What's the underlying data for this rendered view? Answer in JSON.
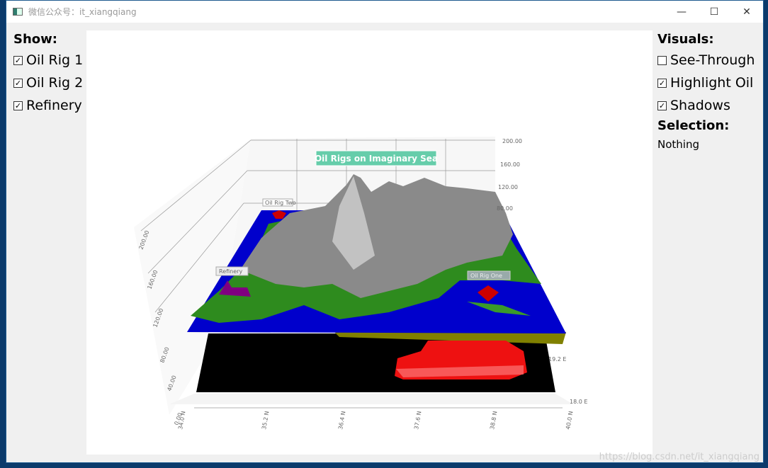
{
  "window": {
    "title": "微信公众号：it_xiangqiang",
    "minimize": "—",
    "maximize": "☐",
    "close": "✕"
  },
  "show": {
    "header": "Show:",
    "items": [
      {
        "label": "Oil Rig 1",
        "checked": true
      },
      {
        "label": "Oil Rig 2",
        "checked": true
      },
      {
        "label": "Refinery",
        "checked": true
      }
    ]
  },
  "visuals": {
    "header": "Visuals:",
    "items": [
      {
        "label": "See-Through",
        "checked": false
      },
      {
        "label": "Highlight Oil",
        "checked": true
      },
      {
        "label": "Shadows",
        "checked": true
      }
    ]
  },
  "selection": {
    "header": "Selection:",
    "value": "Nothing"
  },
  "graph": {
    "title": "Oil Rigs on Imaginary Sea",
    "title_color": "#66cdaa",
    "labels": {
      "rig1": "Oil Rig One",
      "rig2": "Oil Rig Two",
      "refinery": "Refinery"
    },
    "y_ticks_right": [
      "200.00",
      "160.00",
      "120.00",
      "80.00"
    ],
    "y_ticks_left": [
      "200.00",
      "160.00",
      "120.00",
      "80.00",
      "40.00",
      "0.00"
    ],
    "x_ticks": [
      "34.0 N",
      "35.2 N",
      "36.4 N",
      "37.6 N",
      "38.8 N",
      "40.0 N"
    ],
    "z_ticks": [
      "19.2 E",
      "18.0 E"
    ],
    "colors": {
      "sea": "#0000cc",
      "land": "#2e8b1e",
      "mountain": "#8a8a8a",
      "oil": "#ff0000",
      "rig": "#cc0000",
      "refinery": "#800080",
      "floor": "#000000",
      "seabed": "#808000"
    }
  },
  "watermark": "https://blog.csdn.net/it_xiangqiang"
}
